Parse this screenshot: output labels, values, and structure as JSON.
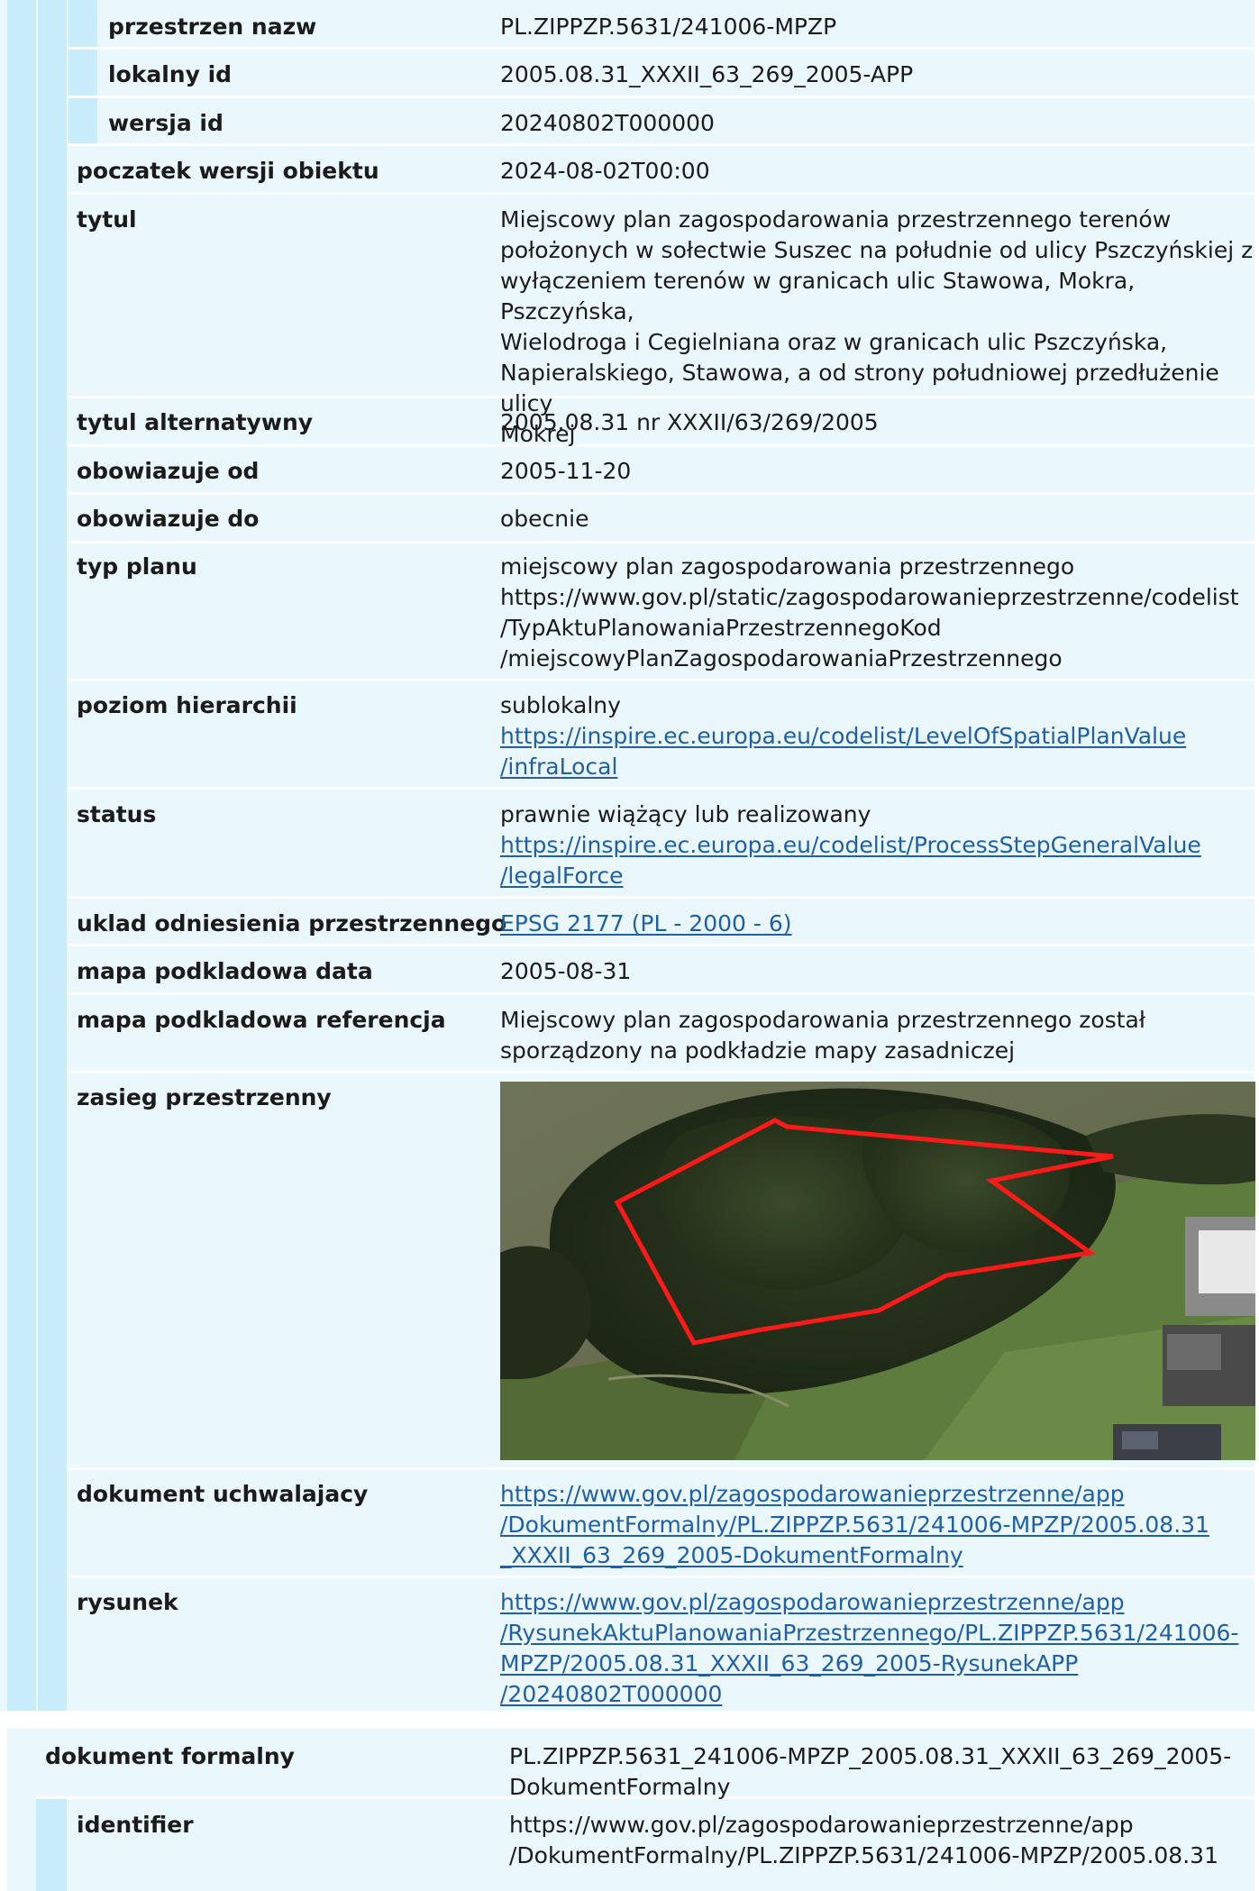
{
  "upper_section": {
    "nested_rows": [
      {
        "label": "przestrzen nazw",
        "value": "PL.ZIPPZP.5631/241006-MPZP"
      },
      {
        "label": "lokalny id",
        "value": "2005.08.31_XXXII_63_269_2005-APP"
      },
      {
        "label": "wersja id",
        "value": "20240802T000000"
      }
    ],
    "rows": [
      {
        "label": "poczatek wersji obiektu",
        "value": "2024-08-02T00:00"
      },
      {
        "label": "tytul",
        "value": "Miejscowy plan zagospodarowania przestrzennego terenów\npołożonych w sołectwie Suszec na południe od ulicy Pszczyńskiej z\nwyłączeniem terenów w granicach ulic Stawowa, Mokra, Pszczyńska,\nWielodroga i Cegielniana oraz w granicach ulic Pszczyńska,\nNapieralskiego, Stawowa, a od strony południowej przedłużenie ulicy\nMokrej"
      },
      {
        "label": "tytul alternatywny",
        "value": "2005.08.31 nr XXXII/63/269/2005"
      },
      {
        "label": "obowiazuje od",
        "value": "2005-11-20"
      },
      {
        "label": "obowiazuje do",
        "value": "obecnie"
      },
      {
        "label": "typ planu",
        "value": "miejscowy plan zagospodarowania przestrzennego\nhttps://www.gov.pl/static/zagospodarowanieprzestrzenne/codelist\n/TypAktuPlanowaniaPrzestrzennegoKod\n/miejscowyPlanZagospodarowaniaPrzestrzennego"
      },
      {
        "label": "poziom hierarchii",
        "value": "sublokalny",
        "link": "https://inspire.ec.europa.eu/codelist/LevelOfSpatialPlanValue\n/infraLocal"
      },
      {
        "label": "status",
        "value": "prawnie wiążący lub realizowany",
        "link": "https://inspire.ec.europa.eu/codelist/ProcessStepGeneralValue\n/legalForce"
      },
      {
        "label": "uklad odniesienia przestrzennego",
        "link": "EPSG 2177 (PL - 2000 - 6)"
      },
      {
        "label": "mapa podkladowa data",
        "value": "2005-08-31"
      },
      {
        "label": "mapa podkladowa referencja",
        "value": "Miejscowy plan zagospodarowania przestrzennego został\nsporządzony na podkładzie mapy zasadniczej"
      },
      {
        "label": "zasieg przestrzenny"
      },
      {
        "label": "dokument uchwalajacy",
        "link": "https://www.gov.pl/zagospodarowanieprzestrzenne/app\n/DokumentFormalny/PL.ZIPPZP.5631/241006-MPZP/2005.08.31\n_XXXII_63_269_2005-DokumentFormalny"
      },
      {
        "label": "rysunek",
        "link": "https://www.gov.pl/zagospodarowanieprzestrzenne/app\n/RysunekAktuPlanowaniaPrzestrzennego/PL.ZIPPZP.5631/241006-\nMPZP/2005.08.31_XXXII_63_269_2005-RysunekAPP\n/20240802T000000"
      }
    ]
  },
  "lower_section": {
    "header": {
      "label": "dokument formalny",
      "value": "PL.ZIPPZP.5631_241006-MPZP_2005.08.31_XXXII_63_269_2005-\nDokumentFormalny"
    },
    "rows": [
      {
        "label": "identifier",
        "value": "https://www.gov.pl/zagospodarowanieprzestrzenne/app\n/DokumentFormalny/PL.ZIPPZP.5631/241006-MPZP/2005.08.31"
      }
    ]
  },
  "colors": {
    "row_background": "#eaf7fd",
    "bar_outer": "#c9ecfb",
    "bar_inner": "#c9ecfb",
    "link": "#1f5fa8",
    "extent_outline": "#ff1a1a"
  },
  "map_image": {
    "content": "aerial-photo-with-red-extent-outline"
  }
}
